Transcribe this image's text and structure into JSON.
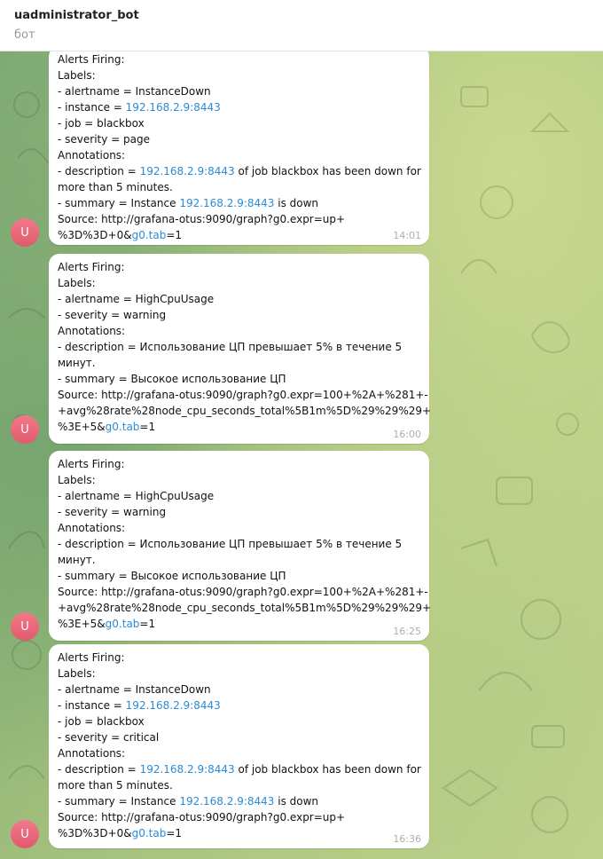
{
  "header": {
    "title": "uadministrator_bot",
    "subtitle": "бот"
  },
  "avatar_letter": "U",
  "messages": [
    {
      "time": "14:01",
      "alerts_firing": "Alerts Firing:",
      "labels": "Labels:",
      "alertname": " - alertname = InstanceDown",
      "instance_prefix": " - instance = ",
      "instance_link": "192.168.2.9:8443",
      "job": " - job = blackbox",
      "severity": " - severity = page",
      "annotations": "Annotations:",
      "description_prefix": " - description = ",
      "description_link": "192.168.2.9:8443",
      "description_suffix": " of job blackbox has been down for",
      "description_cont": "more than 5 minutes.",
      "summary_prefix": " - summary = Instance ",
      "summary_link": "192.168.2.9:8443",
      "summary_suffix": " is down",
      "source_line1": "Source: http://grafana-otus:9090/graph?g0.expr=up+",
      "source_line2_prefix": "%3D%3D+0&",
      "source_link": "g0.tab",
      "source_line2_suffix": "=1"
    },
    {
      "time": "16:00",
      "alerts_firing": "Alerts Firing:",
      "labels": "Labels:",
      "alertname": " - alertname = HighCpuUsage",
      "severity": " - severity = warning",
      "annotations": "Annotations:",
      "description_line1": " - description = Использование ЦП превышает 5% в течение 5",
      "description_line2": "минут.",
      "summary": " - summary = Высокое использование ЦП",
      "source_line1": "Source: http://grafana-otus:9090/graph?g0.expr=100+%2A+%281+-",
      "source_line2": "+avg%28rate%28node_cpu_seconds_total%5B1m%5D%29%29%29+",
      "source_line3_prefix": "%3E+5&",
      "source_link": "g0.tab",
      "source_line3_suffix": "=1"
    },
    {
      "time": "16:25",
      "alerts_firing": "Alerts Firing:",
      "labels": "Labels:",
      "alertname": " - alertname = HighCpuUsage",
      "severity": " - severity = warning",
      "annotations": "Annotations:",
      "description_line1": " - description = Использование ЦП превышает 5% в течение 5",
      "description_line2": "минут.",
      "summary": " - summary = Высокое использование ЦП",
      "source_line1": "Source: http://grafana-otus:9090/graph?g0.expr=100+%2A+%281+-",
      "source_line2": "+avg%28rate%28node_cpu_seconds_total%5B1m%5D%29%29%29+",
      "source_line3_prefix": "%3E+5&",
      "source_link": "g0.tab",
      "source_line3_suffix": "=1"
    },
    {
      "time": "16:36",
      "alerts_firing": "Alerts Firing:",
      "labels": "Labels:",
      "alertname": " - alertname = InstanceDown",
      "instance_prefix": " - instance = ",
      "instance_link": "192.168.2.9:8443",
      "job": " - job = blackbox",
      "severity": " - severity = critical",
      "annotations": "Annotations:",
      "description_prefix": " - description = ",
      "description_link": "192.168.2.9:8443",
      "description_suffix": " of job blackbox has been down for",
      "description_cont": "more than 5 minutes.",
      "summary_prefix": " - summary = Instance ",
      "summary_link": "192.168.2.9:8443",
      "summary_suffix": " is down",
      "source_line1": "Source: http://grafana-otus:9090/graph?g0.expr=up+",
      "source_line2_prefix": "%3D%3D+0&",
      "source_link": "g0.tab",
      "source_line2_suffix": "=1"
    }
  ]
}
